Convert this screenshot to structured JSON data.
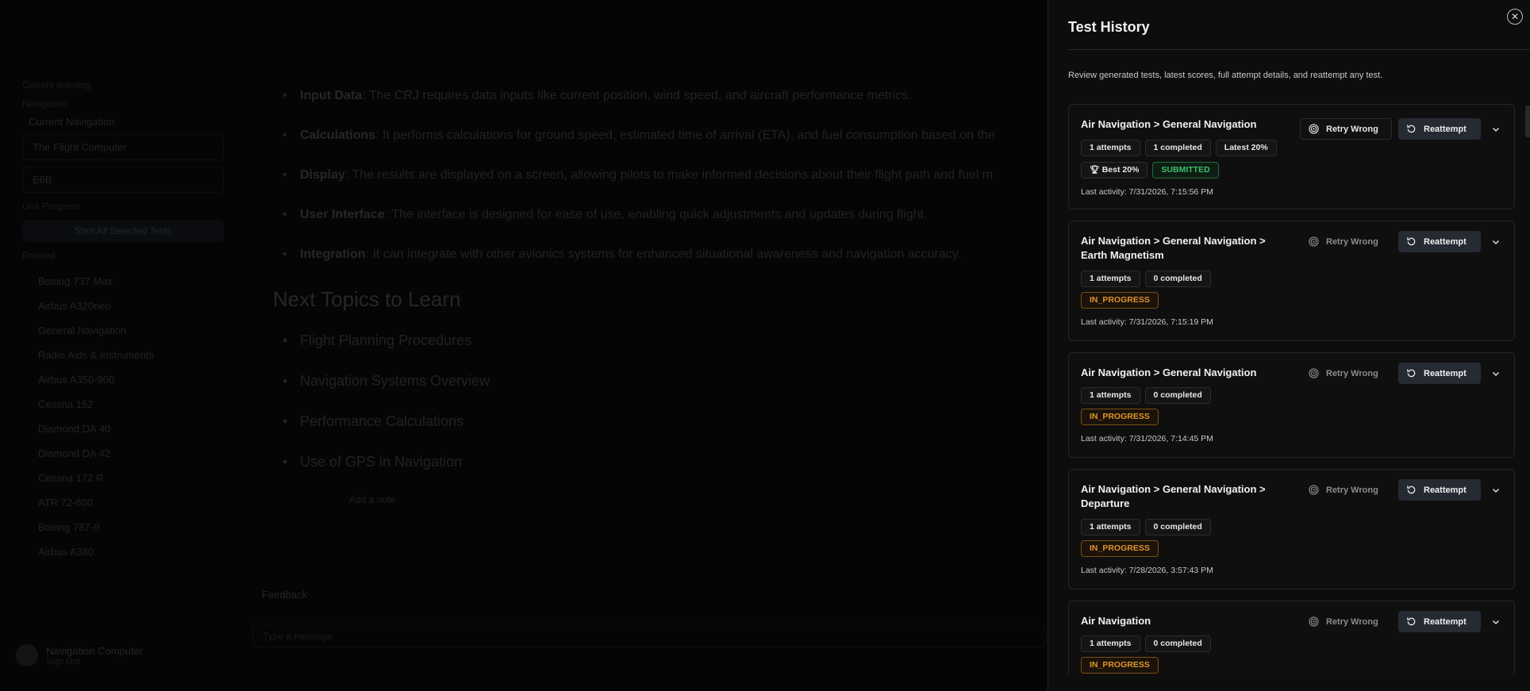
{
  "background": {
    "sidebar": {
      "section_a": "Current learning",
      "section_b": "Navigation",
      "row_a": "Current Navigation",
      "box_a": "The Flight Computer",
      "box_b": "E6B",
      "section_c": "Unit Progress",
      "button": "Start All Selected Tests",
      "section_d": "Related",
      "items": [
        "Boeing 737 Max",
        "Airbus A320neo",
        "General Navigation",
        "Radio Aids & Instruments",
        "Airbus A350-900",
        "Cessna 152",
        "Diamond DA 40",
        "Diamond DA 42",
        "Cessna 172 R",
        "ATR 72-600",
        "Boeing 787-9",
        "Airbus A380"
      ],
      "user_name": "Navigation Computer",
      "user_sub": "Sign Out"
    },
    "main": {
      "bullets": [
        {
          "label": "Input Data",
          "text": ": The CRJ requires data inputs like current position, wind speed, and aircraft performance metrics."
        },
        {
          "label": "Calculations",
          "text": ": It performs calculations for ground speed, estimated time of arrival (ETA), and fuel consumption based on the"
        },
        {
          "label": "Display",
          "text": ": The results are displayed on a screen, allowing pilots to make informed decisions about their flight path and fuel m"
        },
        {
          "label": "User Interface",
          "text": ": The interface is designed for ease of use, enabling quick adjustments and updates during flight."
        },
        {
          "label": "Integration",
          "text": ": It can integrate with other avionics systems for enhanced situational awareness and navigation accuracy."
        }
      ],
      "next_heading": "Next Topics to Learn",
      "topics": [
        "Flight Planning Procedures",
        "Navigation Systems Overview",
        "Performance Calculations",
        "Use of GPS in Navigation"
      ],
      "small_button": "Add a note",
      "feedback": "Feedback",
      "input_placeholder": "Type a message"
    }
  },
  "drawer": {
    "title": "Test History",
    "description": "Review generated tests, latest scores, full attempt details, and reattempt any test.",
    "retry_label": "Retry Wrong",
    "reattempt_label": "Reattempt",
    "cards": [
      {
        "title": "Air Navigation > General Navigation",
        "attempts": "1 attempts",
        "completed": "1 completed",
        "latest": "Latest 20%",
        "best": "Best 20%",
        "status": "SUBMITTED",
        "last_activity": "Last activity: 7/31/2026, 7:15:56 PM"
      },
      {
        "title": "Air Navigation > General Navigation > Earth Magnetism",
        "attempts": "1 attempts",
        "completed": "0 completed",
        "status": "IN_PROGRESS",
        "last_activity": "Last activity: 7/31/2026, 7:15:19 PM"
      },
      {
        "title": "Air Navigation > General Navigation",
        "attempts": "1 attempts",
        "completed": "0 completed",
        "status": "IN_PROGRESS",
        "last_activity": "Last activity: 7/31/2026, 7:14:45 PM"
      },
      {
        "title": "Air Navigation > General Navigation > Departure",
        "attempts": "1 attempts",
        "completed": "0 completed",
        "status": "IN_PROGRESS",
        "last_activity": "Last activity: 7/28/2026, 3:57:43 PM"
      },
      {
        "title": "Air Navigation",
        "attempts": "1 attempts",
        "completed": "0 completed",
        "status": "IN_PROGRESS"
      }
    ]
  },
  "colors": {
    "submitted": "#3fbf6b",
    "in_progress": "#e0932c",
    "reattempt_bg": "#252a33"
  }
}
